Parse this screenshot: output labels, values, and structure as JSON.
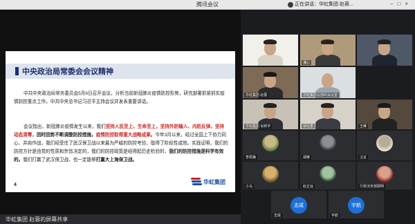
{
  "app": {
    "title": "腾讯会议",
    "speaking": "正在讲话：华虹集团 赵蓉..."
  },
  "slide": {
    "heading": "中央政治局常委会会议精神",
    "p1": "中共中央政治局常务委员会5月8日召开会议，分析当前新冠肺炎疫情防控形势，研究部署抓紧抓实疫情防控重点工作。中共中央总书记习近平主持会议并发表重要讲话。",
    "p2_a": "会议指出，新冠肺炎疫情发生以来，我们",
    "p2_b": "坚持人民至上、生命至上，坚持外防输入、内防反弹，坚持动态清零，",
    "p2_c": "因时因势不断调整防控措施，",
    "p2_d": "疫情防控取得重大战略成果。",
    "p2_e": "今年3月以来，经过全国上下协力同心、并肩作战，我们经受住了武汉保卫战以来最为严峻的防控考验，取得了阶段性成效。实践证明，我们的防控方针是由党的性质和宗旨决定的，我们的防控政策是经得起历史检验的，",
    "p2_f": "我们的防控措施是科学有效的。",
    "p2_g": "我们打赢了武汉保卫战，也一定能够",
    "p2_h": "打赢大上海保卫战。",
    "page": "4",
    "logo": "华虹集团"
  },
  "share_label": "华虹集团 赵蓉的屏幕共享",
  "participants": [
    {
      "name": "",
      "type": "photo"
    },
    {
      "name": "潘心",
      "type": "photo"
    },
    {
      "name": "",
      "type": "photo"
    },
    {
      "name": "华虹集团 赵蓉",
      "type": "photo"
    },
    {
      "name": "华虹集团总部的会议室",
      "type": "photo"
    },
    {
      "name": "华虹集团 肖新宇",
      "type": "photo"
    },
    {
      "name": "徐任重",
      "type": "photo"
    },
    {
      "name": "王峰",
      "type": "photo"
    },
    {
      "name": "李凯静",
      "type": "avatar"
    },
    {
      "name": "胡琳",
      "type": "avatar"
    },
    {
      "name": "汪言",
      "type": "avatar"
    },
    {
      "name": "小马",
      "type": "avatar"
    },
    {
      "name": "赵正远",
      "type": "avatar"
    },
    {
      "name": "行政法务部顾明",
      "type": "avatar"
    },
    {
      "name": "志成",
      "type": "initial",
      "initial": "志成"
    },
    {
      "name": "宇航",
      "type": "initial",
      "initial": "宇航"
    }
  ],
  "colors": {
    "accent": "#1f6fd6",
    "slide_heading": "#1c2f6e",
    "highlight": "#d12222"
  }
}
